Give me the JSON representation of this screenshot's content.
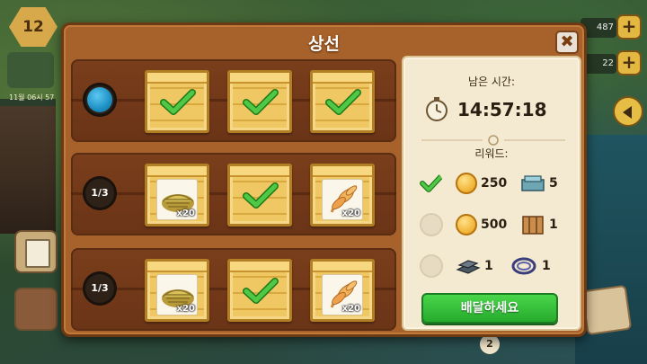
{
  "hud": {
    "level": "12",
    "clock": "11월 06시 57",
    "resource_1": "487",
    "resource_2": "22",
    "plus_label": "+",
    "bottom_badge": "2"
  },
  "dialog": {
    "title": "상선",
    "close_label": "✖"
  },
  "shipments": [
    {
      "status": "active",
      "count_label": "",
      "crates": [
        {
          "state": "done"
        },
        {
          "state": "done"
        },
        {
          "state": "done"
        }
      ]
    },
    {
      "status": "pending",
      "count_label": "1/3",
      "crates": [
        {
          "state": "item",
          "item": "hay-bale",
          "qty": "x20"
        },
        {
          "state": "done"
        },
        {
          "state": "item",
          "item": "wheat-sheaf",
          "qty": "x20"
        }
      ]
    },
    {
      "status": "pending",
      "count_label": "1/3",
      "crates": [
        {
          "state": "item",
          "item": "hay-bale",
          "qty": "x20"
        },
        {
          "state": "done"
        },
        {
          "state": "item",
          "item": "wheat-sheaf",
          "qty": "x20"
        }
      ]
    }
  ],
  "rewards_panel": {
    "time_label": "남은 시간:",
    "timer": "14:57:18",
    "rewards_label": "리워드:",
    "rewards": [
      {
        "claimed": true,
        "coins": "250",
        "item_icon": "metal-box-icon",
        "item_qty": "5"
      },
      {
        "claimed": false,
        "coins": "500",
        "item_icon": "wooden-crate-icon",
        "item_qty": "1"
      },
      {
        "claimed": false,
        "item1_icon": "iron-bar-icon",
        "item1_qty": "1",
        "item2_icon": "rope-coil-icon",
        "item2_qty": "1"
      }
    ],
    "deliver_label": "배달하세요"
  },
  "colors": {
    "check_green": "#3fb83a",
    "deliver_button": "#2fbf34",
    "panel_bg": "#f4ead2",
    "dialog_bg": "#a7612a"
  }
}
